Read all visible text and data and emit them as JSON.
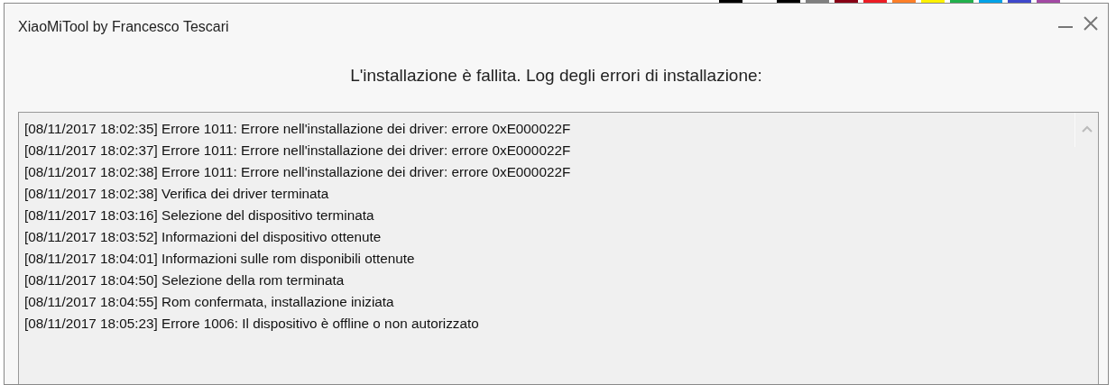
{
  "window": {
    "title": "XiaoMiTool by Francesco Tescari"
  },
  "heading": "L'installazione è fallita. Log degli errori di installazione:",
  "log": [
    "[08/11/2017 18:02:35] Errore 1011: Errore nell'installazione dei driver: errore 0xE000022F",
    "[08/11/2017 18:02:37] Errore 1011: Errore nell'installazione dei driver: errore 0xE000022F",
    "[08/11/2017 18:02:38] Errore 1011: Errore nell'installazione dei driver: errore 0xE000022F",
    "[08/11/2017 18:02:38] Verifica dei driver terminata",
    "[08/11/2017 18:03:16] Selezione del dispositivo terminata",
    "[08/11/2017 18:03:52] Informazioni del dispositivo ottenute",
    "[08/11/2017 18:04:01] Informazioni sulle rom disponibili ottenute",
    "[08/11/2017 18:04:50] Selezione della rom terminata",
    "[08/11/2017 18:04:55] Rom confermata, installazione iniziata",
    "[08/11/2017 18:05:23] Errore 1006: Il dispositivo è offline o non autorizzato"
  ]
}
